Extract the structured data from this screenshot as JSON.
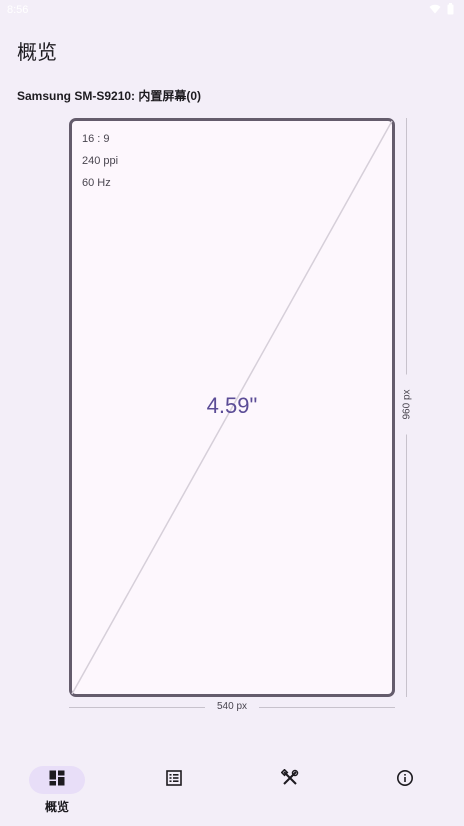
{
  "status_bar": {
    "time": "8:56"
  },
  "app_bar": {
    "title": "概览"
  },
  "device": {
    "label": "Samsung SM-S9210: 内置屏幕(0)"
  },
  "screen_specs": {
    "aspect_ratio": "16 : 9",
    "density": "240 ppi",
    "refresh_rate": "60 Hz",
    "diagonal": "4.59\"",
    "height_px": "960 px",
    "width_px": "540 px"
  },
  "bottom_nav": {
    "items": [
      {
        "label": "概览",
        "icon": "dashboard-icon",
        "active": true
      },
      {
        "label": "",
        "icon": "list-icon",
        "active": false
      },
      {
        "label": "",
        "icon": "tools-icon",
        "active": false
      },
      {
        "label": "",
        "icon": "info-icon",
        "active": false
      }
    ]
  },
  "colors": {
    "background": "#f3eef8",
    "screen_fill": "#fdf7fd",
    "screen_border": "#645c6c",
    "accent": "#5b4c96",
    "nav_active": "#e8def8"
  }
}
